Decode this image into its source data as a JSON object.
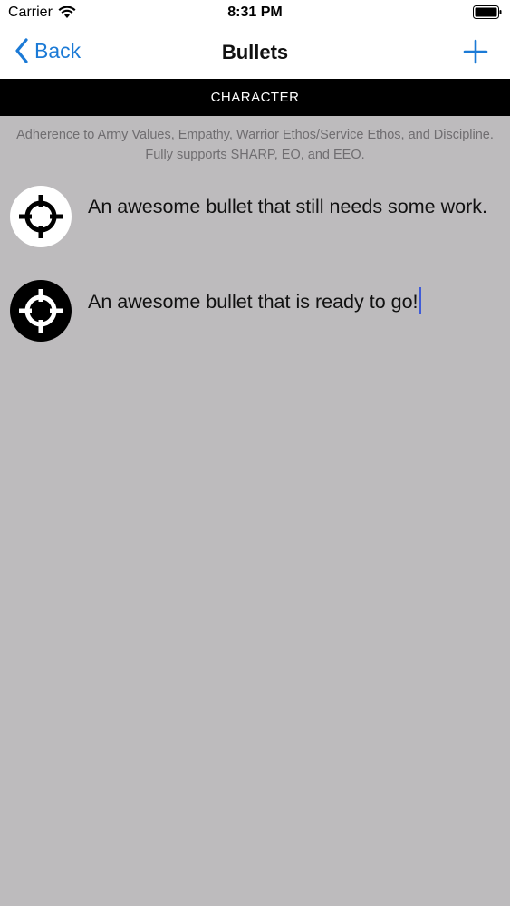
{
  "status_bar": {
    "carrier": "Carrier",
    "time": "8:31 PM"
  },
  "nav": {
    "back_label": "Back",
    "title": "Bullets",
    "add_icon": "plus-icon"
  },
  "section": {
    "header": "CHARACTER",
    "description": "Adherence to Army Values, Empathy, Warrior Ethos/Service Ethos, and Discipline. Fully supports SHARP, EO, and EEO."
  },
  "bullets": [
    {
      "text": "An awesome bullet that still needs some work.",
      "icon": "crosshair-white-icon",
      "status": "needs-work"
    },
    {
      "text": "An awesome bullet that is ready to go!",
      "icon": "crosshair-black-icon",
      "status": "ready"
    }
  ],
  "colors": {
    "accent": "#1b7ad6",
    "background": "#bdbbbd",
    "header_bg": "#000000",
    "cursor": "#3f5bd8"
  }
}
